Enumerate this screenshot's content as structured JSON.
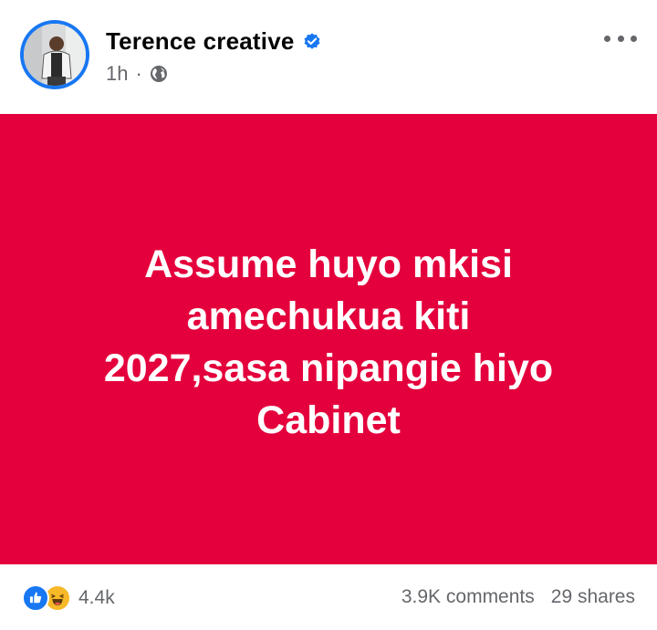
{
  "post": {
    "author": "Terence creative",
    "verified": true,
    "time": "1h",
    "separator": "·",
    "audience_icon": "globe-icon",
    "more_icon": "more-options-icon",
    "text_lines": [
      "Assume huyo mkisi",
      "amechukua kiti",
      "2027,sasa nipangie hiyo",
      "Cabinet"
    ],
    "background_color": "#e4003c"
  },
  "footer": {
    "reactions": [
      "like-icon",
      "haha-icon"
    ],
    "reaction_count": "4.4k",
    "comments": "3.9K comments",
    "shares": "29 shares"
  },
  "colors": {
    "accent": "#1877f2",
    "text_primary": "#050505",
    "text_secondary": "#65676b"
  }
}
